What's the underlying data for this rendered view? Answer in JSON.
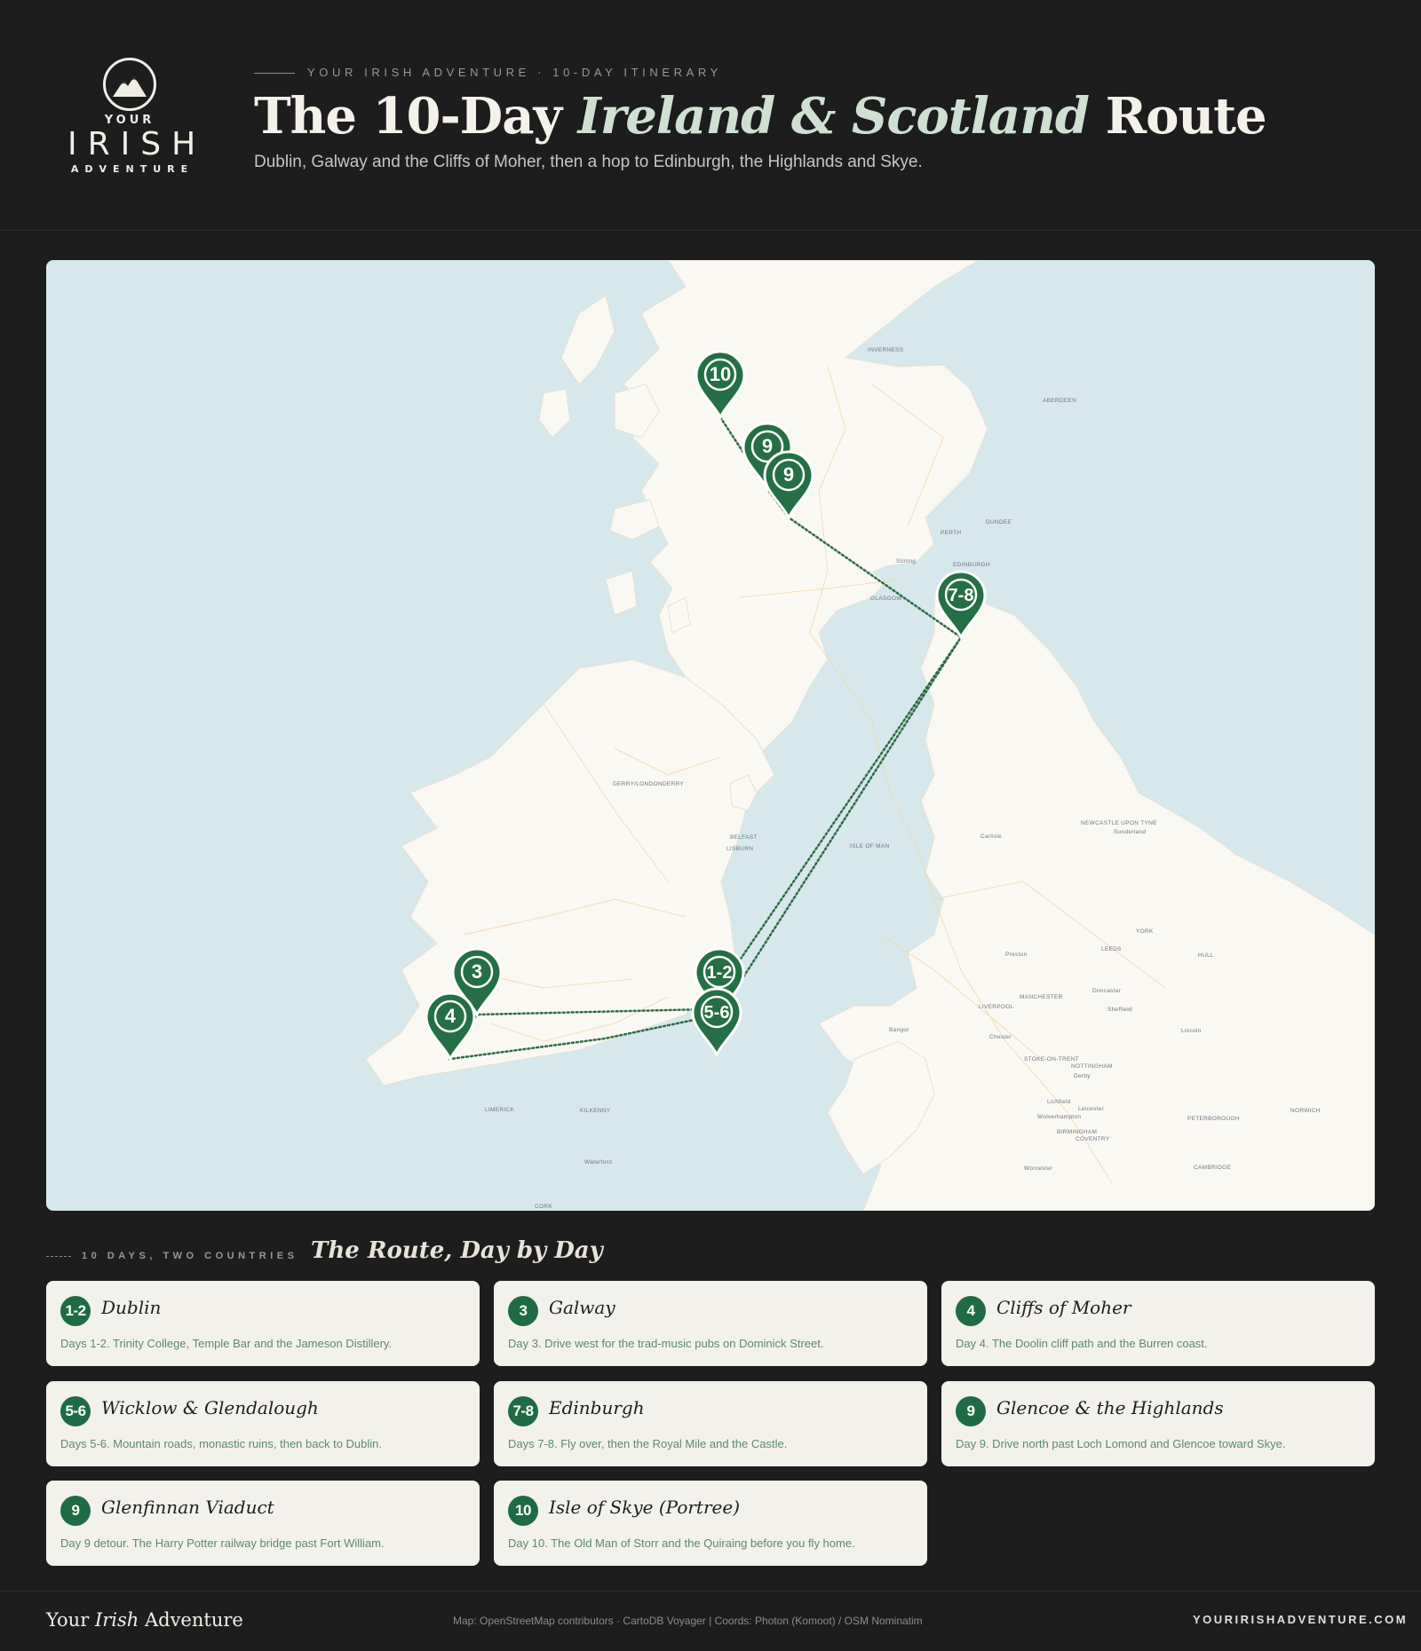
{
  "brand": {
    "your": "YOUR",
    "irish": "IRISH",
    "adventure": "ADVENTURE"
  },
  "header": {
    "eyebrow": "YOUR IRISH ADVENTURE · 10-DAY ITINERARY",
    "title_before": "The 10-Day ",
    "title_em": "Ireland & Scotland",
    "title_after": " Route",
    "subtitle": "Dublin, Galway and the Cliffs of Moher, then a hop to Edinburgh, the Highlands and Skye."
  },
  "map": {
    "colors": {
      "sea": "#d6e8eb",
      "land": "#faf8f3",
      "route": "#2e6b46",
      "pin": "#246f45"
    },
    "labels": [
      "INVERNESS",
      "ABERDEEN",
      "DUNDEE",
      "PERTH",
      "Stirling",
      "EDINBURGH",
      "GLASGOW",
      "DERRY/LONDONDERRY",
      "BELFAST",
      "LISBURN",
      "ISLE OF MAN",
      "NEWCASTLE UPON TYNE",
      "Sunderland",
      "Carlisle",
      "YORK",
      "LEEDS",
      "HULL",
      "Preston",
      "MANCHESTER",
      "LIVERPOOL",
      "Doncaster",
      "Sheffield",
      "Lincoln",
      "Chester",
      "Bangor",
      "STOKE-ON-TRENT",
      "NOTTINGHAM",
      "Derby",
      "Leicester",
      "Lichfield",
      "Wolverhampton",
      "BIRMINGHAM",
      "COVENTRY",
      "PETERBOROUGH",
      "NORWICH",
      "CAMBRIDGE",
      "Worcester",
      "LIMERICK",
      "KILKENNY",
      "Waterford",
      "CORK"
    ],
    "pins": [
      {
        "label": "10",
        "place": "Isle of Skye (Portree)"
      },
      {
        "label": "9",
        "place": "Glenfinnan Viaduct"
      },
      {
        "label": "9",
        "place": "Glencoe & the Highlands"
      },
      {
        "label": "7-8",
        "place": "Edinburgh"
      },
      {
        "label": "1-2",
        "place": "Dublin"
      },
      {
        "label": "5-6",
        "place": "Wicklow & Glendalough"
      },
      {
        "label": "3",
        "place": "Galway"
      },
      {
        "label": "4",
        "place": "Cliffs of Moher"
      }
    ]
  },
  "section": {
    "eyebrow": "10 DAYS, TWO COUNTRIES",
    "title": "The Route, Day by Day"
  },
  "stops": [
    {
      "badge": "1-2",
      "name": "Dublin",
      "desc": "Days 1-2. Trinity College, Temple Bar and the Jameson Distillery."
    },
    {
      "badge": "3",
      "name": "Galway",
      "desc": "Day 3. Drive west for the trad-music pubs on Dominick Street."
    },
    {
      "badge": "4",
      "name": "Cliffs of Moher",
      "desc": "Day 4. The Doolin cliff path and the Burren coast."
    },
    {
      "badge": "5-6",
      "name": "Wicklow & Glendalough",
      "desc": "Days 5-6. Mountain roads, monastic ruins, then back to Dublin."
    },
    {
      "badge": "7-8",
      "name": "Edinburgh",
      "desc": "Days 7-8. Fly over, then the Royal Mile and the Castle."
    },
    {
      "badge": "9",
      "name": "Glencoe & the Highlands",
      "desc": "Day 9. Drive north past Loch Lomond and Glencoe toward Skye."
    },
    {
      "badge": "9",
      "name": "Glenfinnan Viaduct",
      "desc": "Day 9 detour. The Harry Potter railway bridge past Fort William."
    },
    {
      "badge": "10",
      "name": "Isle of Skye (Portree)",
      "desc": "Day 10. The Old Man of Storr and the Quiraing before you fly home."
    }
  ],
  "footer": {
    "brand_before": "Your ",
    "brand_em": "Irish",
    "brand_after": " Adventure",
    "credit": "Map: OpenStreetMap contributors · CartoDB Voyager | Coords: Photon (Komoot) / OSM Nominatim",
    "url": "YOURIRISHADVENTURE.COM"
  }
}
